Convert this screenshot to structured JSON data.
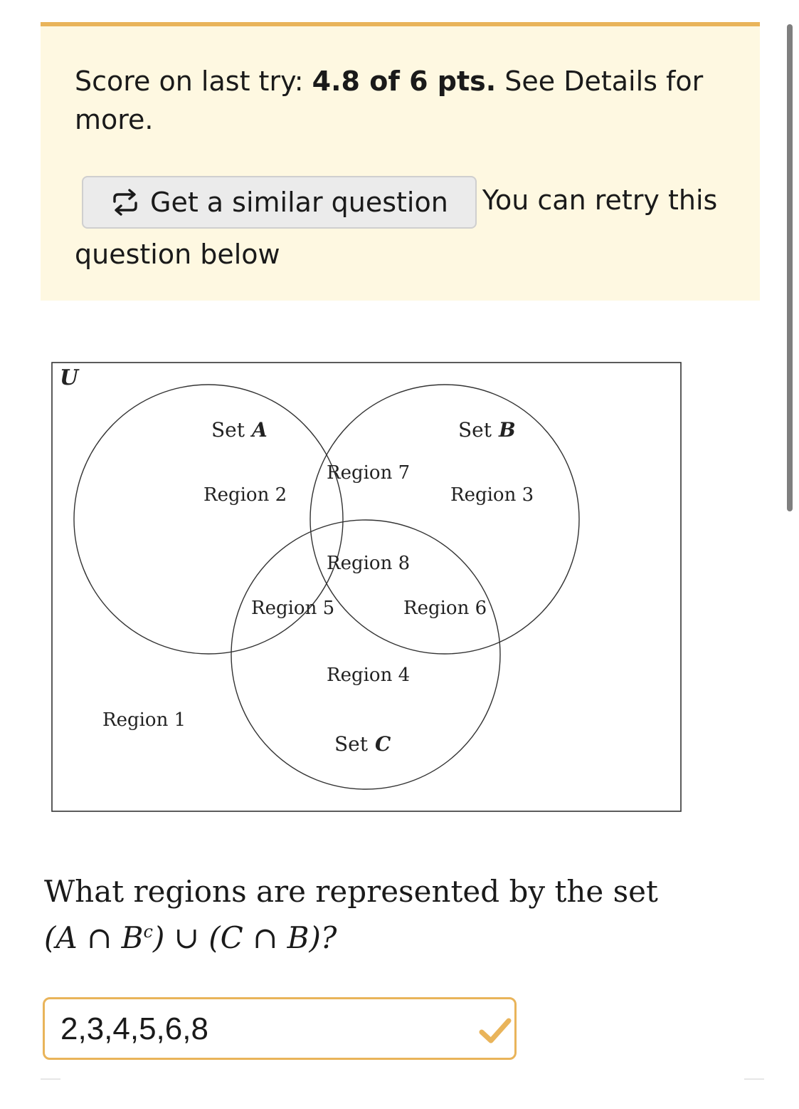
{
  "banner": {
    "score_prefix": "Score on last try: ",
    "score_value": "4.8 of 6 pts.",
    "score_suffix": " See Details for more.",
    "similar_button_label": "Get a similar question",
    "retry_text": "You can retry this question below",
    "icon": "repeat-icon",
    "accent_color": "#e9b45a",
    "background_color": "#fef8e1"
  },
  "diagram": {
    "universe_label": "U",
    "set_a_label": "Set",
    "set_a_var": "A",
    "set_b_label": "Set",
    "set_b_var": "B",
    "set_c_label": "Set",
    "set_c_var": "C",
    "regions": {
      "r1": "Region 1",
      "r2": "Region 2",
      "r3": "Region 3",
      "r4": "Region 4",
      "r5": "Region 5",
      "r6": "Region 6",
      "r7": "Region 7",
      "r8": "Region 8"
    }
  },
  "question": {
    "text": "What regions are represented by the set",
    "expression": "(A ∩ B",
    "superscript": "c",
    "expression_rest": ") ∪ (C ∩ B)?"
  },
  "answer": {
    "value": "2,3,4,5,6,8",
    "status_icon": "check-icon",
    "status_color": "#e9b45a"
  }
}
